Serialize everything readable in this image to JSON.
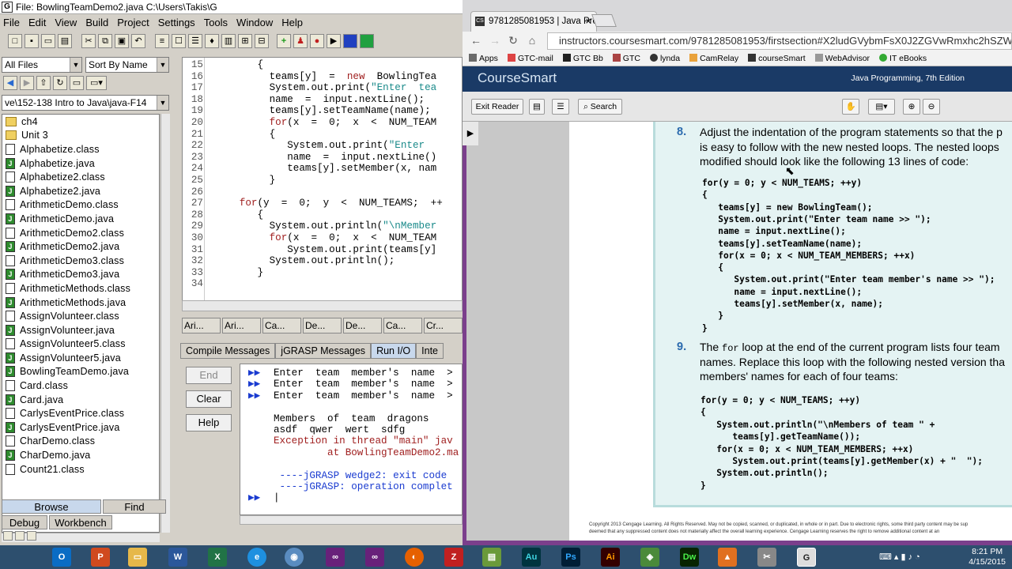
{
  "jgrasp": {
    "title": "File: BowlingTeamDemo2.java  C:\\Users\\Takis\\G",
    "menu": [
      "File",
      "Edit",
      "View",
      "Build",
      "Project",
      "Settings",
      "Tools",
      "Window",
      "Help"
    ],
    "filter": "All Files",
    "sort": "Sort By Name",
    "path": "ve\\152-138 Intro to Java\\java-F14",
    "files": [
      {
        "name": "ch4",
        "type": "folder"
      },
      {
        "name": "Unit 3",
        "type": "folder"
      },
      {
        "name": "Alphabetize.class",
        "type": "class"
      },
      {
        "name": "Alphabetize.java",
        "type": "java"
      },
      {
        "name": "Alphabetize2.class",
        "type": "class"
      },
      {
        "name": "Alphabetize2.java",
        "type": "java"
      },
      {
        "name": "ArithmeticDemo.class",
        "type": "class"
      },
      {
        "name": "ArithmeticDemo.java",
        "type": "java"
      },
      {
        "name": "ArithmeticDemo2.class",
        "type": "class"
      },
      {
        "name": "ArithmeticDemo2.java",
        "type": "java"
      },
      {
        "name": "ArithmeticDemo3.class",
        "type": "class"
      },
      {
        "name": "ArithmeticDemo3.java",
        "type": "java"
      },
      {
        "name": "ArithmeticMethods.class",
        "type": "class"
      },
      {
        "name": "ArithmeticMethods.java",
        "type": "java"
      },
      {
        "name": "AssignVolunteer.class",
        "type": "class"
      },
      {
        "name": "AssignVolunteer.java",
        "type": "java"
      },
      {
        "name": "AssignVolunteer5.class",
        "type": "class"
      },
      {
        "name": "AssignVolunteer5.java",
        "type": "java"
      },
      {
        "name": "BowlingTeamDemo.java",
        "type": "java"
      },
      {
        "name": "Card.class",
        "type": "class"
      },
      {
        "name": "Card.java",
        "type": "java"
      },
      {
        "name": "CarlysEventPrice.class",
        "type": "class"
      },
      {
        "name": "CarlysEventPrice.java",
        "type": "java"
      },
      {
        "name": "CharDemo.class",
        "type": "class"
      },
      {
        "name": "CharDemo.java",
        "type": "java"
      },
      {
        "name": "Count21.class",
        "type": "class"
      }
    ],
    "browse_tab": "Browse",
    "find_tab": "Find",
    "debug_tab": "Debug",
    "workbench_tab": "Workbench",
    "code_lines": [
      {
        "n": "15",
        "code": "        {"
      },
      {
        "n": "16",
        "code": "          teams[y]  =  new  BowlingTea"
      },
      {
        "n": "17",
        "code": "          System.out.print(\"Enter  tea"
      },
      {
        "n": "18",
        "code": "          name  =  input.nextLine();"
      },
      {
        "n": "19",
        "code": "          teams[y].setTeamName(name);"
      },
      {
        "n": "20",
        "code": "          for(x  =  0;  x  <  NUM_TEAM"
      },
      {
        "n": "21",
        "code": "          {"
      },
      {
        "n": "22",
        "code": "             System.out.print(\"Enter  "
      },
      {
        "n": "23",
        "code": "             name  =  input.nextLine()"
      },
      {
        "n": "24",
        "code": "             teams[y].setMember(x, nam"
      },
      {
        "n": "25",
        "code": "          }"
      },
      {
        "n": "26",
        "code": ""
      },
      {
        "n": "27",
        "code": "     for(y  =  0;  y  <  NUM_TEAMS;  ++"
      },
      {
        "n": "28",
        "code": "        {"
      },
      {
        "n": "29",
        "code": "          System.out.println(\"\\nMember"
      },
      {
        "n": "30",
        "code": "          for(x  =  0;  x  <  NUM_TEAM"
      },
      {
        "n": "31",
        "code": "             System.out.print(teams[y]"
      },
      {
        "n": "32",
        "code": "          System.out.println();"
      },
      {
        "n": "33",
        "code": "        }"
      },
      {
        "n": "34",
        "code": ""
      }
    ],
    "editor_tabs": [
      "Ari...",
      "Ari...",
      "Ca...",
      "De...",
      "De...",
      "Ca...",
      "Cr..."
    ],
    "message_tabs": [
      "Compile Messages",
      "jGRASP Messages",
      "Run I/O",
      "Inte"
    ],
    "run_buttons": {
      "end": "End",
      "clear": "Clear",
      "help": "Help"
    },
    "output_lines": [
      {
        "prompt": "▶▶",
        "text": "Enter  team  member's  name  >"
      },
      {
        "prompt": "▶▶",
        "text": "Enter  team  member's  name  >"
      },
      {
        "prompt": "▶▶",
        "text": "Enter  team  member's  name  >"
      },
      {
        "prompt": "",
        "text": ""
      },
      {
        "prompt": "",
        "text": "Members  of  team  dragons"
      },
      {
        "prompt": "",
        "text": "asdf  qwer  wert  sdfg"
      },
      {
        "prompt": "",
        "text": "Exception in thread \"main\" jav"
      },
      {
        "prompt": "",
        "text": "         at BowlingTeamDemo2.ma"
      },
      {
        "prompt": "",
        "text": ""
      },
      {
        "prompt": "",
        "text": " ----jGRASP wedge2: exit code"
      },
      {
        "prompt": "",
        "text": " ----jGRASP: operation complet"
      },
      {
        "prompt": "▶▶",
        "text": "|"
      }
    ]
  },
  "browser": {
    "tab_title": "9781285081953 | Java Pro",
    "tab_favicon": "CS",
    "url": "instructors.coursesmart.com/9781285081953/firstsection#X2ludGVybmFsX0J2ZGVwRmxhc2hSZWFkZX",
    "bookmarks": [
      "Apps",
      "GTC-mail",
      "GTC Bb",
      "GTC",
      "lynda",
      "CamRelay",
      "courseSmart",
      "WebAdvisor",
      "IT eBooks"
    ],
    "logo": "CourseSmart",
    "book_title": "Java Programming, 7th Edition",
    "exit_reader": "Exit Reader",
    "search": "Search",
    "item8_num": "8.",
    "item8_text": [
      "Adjust the indentation of the program statements so that the p",
      "is easy to follow with the new nested loops. The nested loops",
      "modified should look like the following 13 lines of code:"
    ],
    "item8_code": [
      "for(y = 0; y < NUM_TEAMS; ++y)",
      "{",
      "   teams[y] = new BowlingTeam();",
      "   System.out.print(\"Enter team name >> \");",
      "   name = input.nextLine();",
      "   teams[y].setTeamName(name);",
      "   for(x = 0; x < NUM_TEAM_MEMBERS; ++x)",
      "   {",
      "      System.out.print(\"Enter team member's name >> \");",
      "      name = input.nextLine();",
      "      teams[y].setMember(x, name);",
      "   }",
      "}"
    ],
    "item9_num": "9.",
    "item9_text_a": "The ",
    "item9_text_code": "for",
    "item9_text_b": " loop at the end of the current program lists four team",
    "item9_text": [
      "names. Replace this loop with the following nested version tha",
      "members' names for each of four teams:"
    ],
    "item9_code": [
      "for(y = 0; y < NUM_TEAMS; ++y)",
      "{",
      "   System.out.println(\"\\nMembers of team \" +",
      "      teams[y].getTeamName());",
      "   for(x = 0; x < NUM_TEAM_MEMBERS; ++x)",
      "      System.out.print(teams[y].getMember(x) + \"  \");",
      "   System.out.println();",
      "}"
    ],
    "copyright_1": "Copyright 2013 Cengage Learning. All Rights Reserved. May not be copied, scanned, or duplicated, in whole or in part. Due to electronic rights, some third party content may be sup",
    "copyright_2": "deemed that any suppressed content does not materially affect the overall learning experience. Cengage Learning reserves the right to remove additional content at an"
  },
  "taskbar": {
    "time": "8:21 PM",
    "date": "4/15/2015"
  }
}
